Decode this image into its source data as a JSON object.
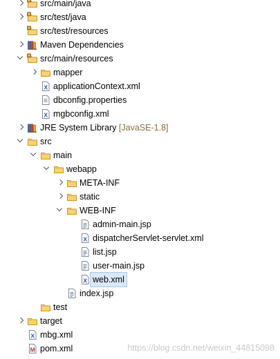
{
  "tree": [
    {
      "label": "src/main/java",
      "icon": "source-folder-icon",
      "level": 1,
      "twisty": "right"
    },
    {
      "label": "src/test/java",
      "icon": "source-folder-icon",
      "level": 1,
      "twisty": "right"
    },
    {
      "label": "src/test/resources",
      "icon": "source-folder-icon",
      "level": 1,
      "twisty": "none"
    },
    {
      "label": "Maven Dependencies",
      "icon": "library-icon",
      "level": 1,
      "twisty": "right"
    },
    {
      "label": "src/main/resources",
      "icon": "source-folder-icon",
      "level": 1,
      "twisty": "down"
    },
    {
      "label": "mapper",
      "icon": "folder-icon",
      "level": 2,
      "twisty": "right"
    },
    {
      "label": "applicationContext.xml",
      "icon": "xml-file-icon",
      "level": 2,
      "twisty": "none"
    },
    {
      "label": "dbconfig.properties",
      "icon": "text-file-icon",
      "level": 2,
      "twisty": "none"
    },
    {
      "label": "mgbconfig.xml",
      "icon": "xml-file-icon",
      "level": 2,
      "twisty": "none"
    },
    {
      "label": "JRE System Library",
      "decoration": "[JavaSE-1.8]",
      "icon": "library-icon",
      "level": 1,
      "twisty": "right"
    },
    {
      "label": "src",
      "icon": "folder-icon",
      "level": 1,
      "twisty": "down"
    },
    {
      "label": "main",
      "icon": "folder-icon",
      "level": 2,
      "twisty": "down"
    },
    {
      "label": "webapp",
      "icon": "folder-icon",
      "level": 3,
      "twisty": "down"
    },
    {
      "label": "META-INF",
      "icon": "folder-icon",
      "level": 4,
      "twisty": "right"
    },
    {
      "label": "static",
      "icon": "folder-icon",
      "level": 4,
      "twisty": "right"
    },
    {
      "label": "WEB-INF",
      "icon": "folder-icon",
      "level": 4,
      "twisty": "down"
    },
    {
      "label": "admin-main.jsp",
      "icon": "jsp-file-icon",
      "level": 5,
      "twisty": "none"
    },
    {
      "label": "dispatcherServlet-servlet.xml",
      "icon": "xml-file-icon",
      "level": 5,
      "twisty": "none"
    },
    {
      "label": "list.jsp",
      "icon": "jsp-file-icon",
      "level": 5,
      "twisty": "none"
    },
    {
      "label": "user-main.jsp",
      "icon": "jsp-file-icon",
      "level": 5,
      "twisty": "none"
    },
    {
      "label": "web.xml",
      "icon": "xml-file-icon",
      "level": 5,
      "twisty": "none",
      "selected": true
    },
    {
      "label": "index.jsp",
      "icon": "jsp-file-icon",
      "level": 4,
      "twisty": "none"
    },
    {
      "label": "test",
      "icon": "folder-icon",
      "level": 2,
      "twisty": "none"
    },
    {
      "label": "target",
      "icon": "folder-icon",
      "level": 1,
      "twisty": "right"
    },
    {
      "label": "mbg.xml",
      "icon": "xml-file-icon",
      "level": 1,
      "twisty": "none"
    },
    {
      "label": "pom.xml",
      "icon": "maven-pom-icon",
      "level": 1,
      "twisty": "none"
    }
  ],
  "watermark": "https://blog.csdn.net/weixin_44815098"
}
